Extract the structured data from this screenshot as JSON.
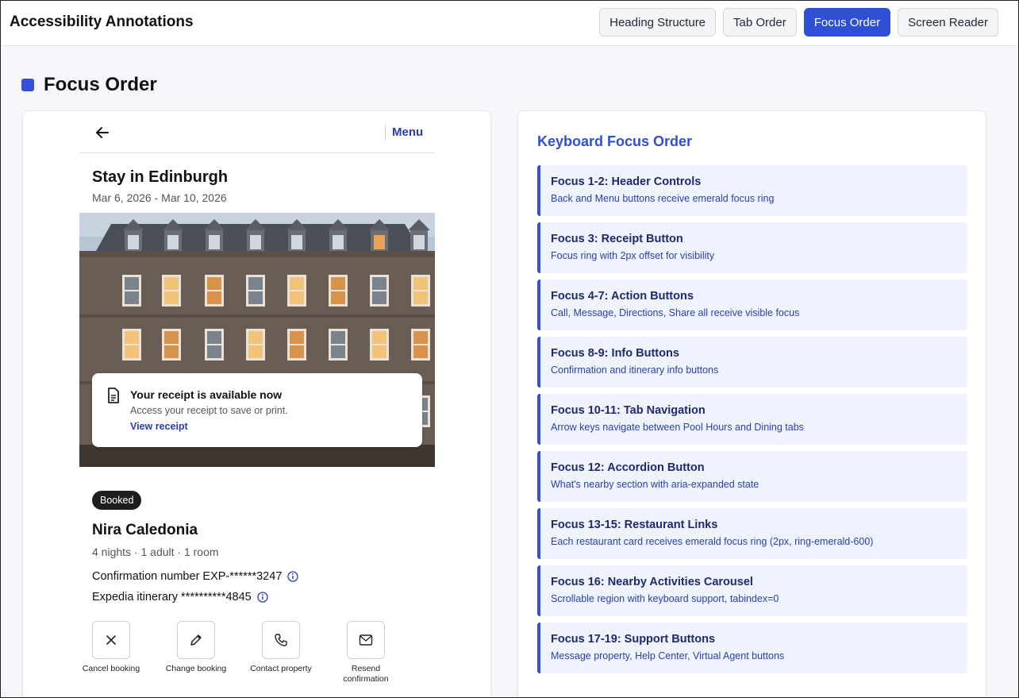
{
  "app": {
    "title": "Accessibility Annotations"
  },
  "tabs": [
    {
      "label": "Heading Structure",
      "active": false
    },
    {
      "label": "Tab Order",
      "active": false
    },
    {
      "label": "Focus Order",
      "active": true
    },
    {
      "label": "Screen Reader",
      "active": false
    }
  ],
  "section": {
    "title": "Focus Order",
    "accent_color": "#3550d9"
  },
  "mock": {
    "menu_label": "Menu",
    "stay_title": "Stay in Edinburgh",
    "stay_dates": "Mar 6, 2026 - Mar 10, 2026",
    "receipt": {
      "title": "Your receipt is available now",
      "subtitle": "Access your receipt to save or print.",
      "link": "View receipt"
    },
    "status_badge": "Booked",
    "hotel_name": "Nira Caledonia",
    "hotel_meta": "4 nights · 1 adult · 1 room",
    "confirmation": "Confirmation number EXP-******3247",
    "itinerary": "Expedia itinerary **********4845",
    "actions": [
      {
        "label": "Cancel booking",
        "icon": "close-icon"
      },
      {
        "label": "Change booking",
        "icon": "pencil-icon"
      },
      {
        "label": "Contact property",
        "icon": "phone-icon"
      },
      {
        "label": "Resend confirmation",
        "icon": "mail-icon"
      }
    ]
  },
  "keyboard_focus": {
    "title": "Keyboard Focus Order",
    "items": [
      {
        "title": "Focus 1-2: Header Controls",
        "desc": "Back and Menu buttons receive emerald focus ring"
      },
      {
        "title": "Focus 3: Receipt Button",
        "desc": "Focus ring with 2px offset for visibility"
      },
      {
        "title": "Focus 4-7: Action Buttons",
        "desc": "Call, Message, Directions, Share all receive visible focus"
      },
      {
        "title": "Focus 8-9: Info Buttons",
        "desc": "Confirmation and itinerary info buttons"
      },
      {
        "title": "Focus 10-11: Tab Navigation",
        "desc": "Arrow keys navigate between Pool Hours and Dining tabs"
      },
      {
        "title": "Focus 12: Accordion Button",
        "desc": "What's nearby section with aria-expanded state"
      },
      {
        "title": "Focus 13-15: Restaurant Links",
        "desc": "Each restaurant card receives emerald focus ring (2px, ring-emerald-600)"
      },
      {
        "title": "Focus 16: Nearby Activities Carousel",
        "desc": "Scrollable region with keyboard support, tabindex=0"
      },
      {
        "title": "Focus 17-19: Support Buttons",
        "desc": "Message property, Help Center, Virtual Agent buttons"
      }
    ]
  },
  "colors": {
    "primary": "#2f4fd6",
    "link": "#2a3bb7",
    "item_bg": "#eef3fd"
  }
}
